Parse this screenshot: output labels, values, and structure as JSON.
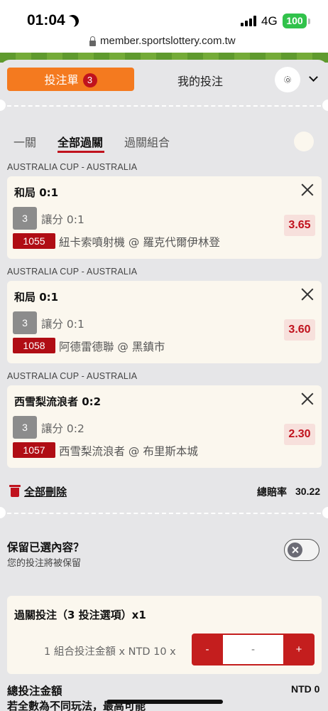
{
  "status_bar": {
    "time": "01:04",
    "network": "4G",
    "battery": "100"
  },
  "browser": {
    "url": "member.sportslottery.com.tw"
  },
  "header": {
    "betslip_tab": "投注單",
    "betslip_count": "3",
    "mybets_tab": "我的投注"
  },
  "sub_tabs": [
    {
      "label": "一關",
      "active": false
    },
    {
      "label": "全部過關",
      "active": true
    },
    {
      "label": "過關組合",
      "active": false
    }
  ],
  "bets": [
    {
      "league": "AUSTRALIA CUP - AUSTRALIA",
      "market": "和局 0:1",
      "selection_no": "3",
      "handicap": "讓分 0:1",
      "match_id": "1055",
      "match": "紐卡索噴射機 @ 羅克代爾伊林登",
      "odds": "3.65"
    },
    {
      "league": "AUSTRALIA CUP - AUSTRALIA",
      "market": "和局 0:1",
      "selection_no": "3",
      "handicap": "讓分 0:1",
      "match_id": "1058",
      "match": "阿德雷德聯 @ 黑鎮市",
      "odds": "3.60"
    },
    {
      "league": "AUSTRALIA CUP - AUSTRALIA",
      "market": "西雪梨流浪者 0:2",
      "selection_no": "3",
      "handicap": "讓分 0:2",
      "match_id": "1057",
      "match": "西雪梨流浪者 @ 布里斯本城",
      "odds": "2.30"
    }
  ],
  "summary": {
    "delete_all": "全部刪除",
    "total_odds_label": "總賠率",
    "total_odds_value": "30.22"
  },
  "retain": {
    "title": "保留已選內容？",
    "subtitle": "您的投注將被保留",
    "enabled": false
  },
  "parlay": {
    "title": "過關投注（3 投注選項）x1",
    "stake_label": "1 組合投注金額 x NTD 10 x",
    "minus": "-",
    "plus": "+",
    "stake_placeholder": "-"
  },
  "total": {
    "label": "總投注金額",
    "value": "NTD 0"
  },
  "cutoff_text": "若全數為不同玩法，最高可能",
  "colors": {
    "accent_orange": "#f47a1f",
    "accent_red": "#c0121d",
    "card_bg": "#fbf7ee"
  }
}
